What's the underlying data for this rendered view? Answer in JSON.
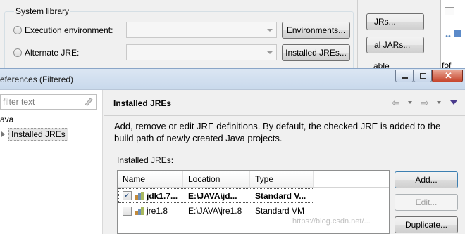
{
  "background_dialog": {
    "group_title": "System library",
    "exec_env_label": "Execution environment:",
    "alt_jre_label": "Alternate JRE:",
    "environments_button": "Environments...",
    "installed_jres_button": "Installed JREs...",
    "right_buttons": [
      "JRs...",
      "al JARs...",
      "able"
    ],
    "right_far_text": "fof"
  },
  "window": {
    "title": "eferences (Filtered)"
  },
  "left_pane": {
    "filter_placeholder": "filter text",
    "tree_parent": "ava",
    "tree_selected": "Installed JREs"
  },
  "page": {
    "title": "Installed JREs",
    "description": "Add, remove or edit JRE definitions. By default, the checked JRE is added to the build path of newly created Java projects.",
    "table_label": "Installed JREs:"
  },
  "table": {
    "columns": [
      "Name",
      "Location",
      "Type"
    ],
    "rows": [
      {
        "checked": true,
        "name": "jdk1.7...",
        "location": "E:\\JAVA\\jd...",
        "type": "Standard V..."
      },
      {
        "checked": false,
        "name": "jre1.8",
        "location": "E:\\JAVA\\jre1.8",
        "type": "Standard VM"
      }
    ]
  },
  "buttons": {
    "add": "Add...",
    "edit": "Edit...",
    "duplicate": "Duplicate..."
  },
  "watermark": "https://blog.csdn.net/..."
}
